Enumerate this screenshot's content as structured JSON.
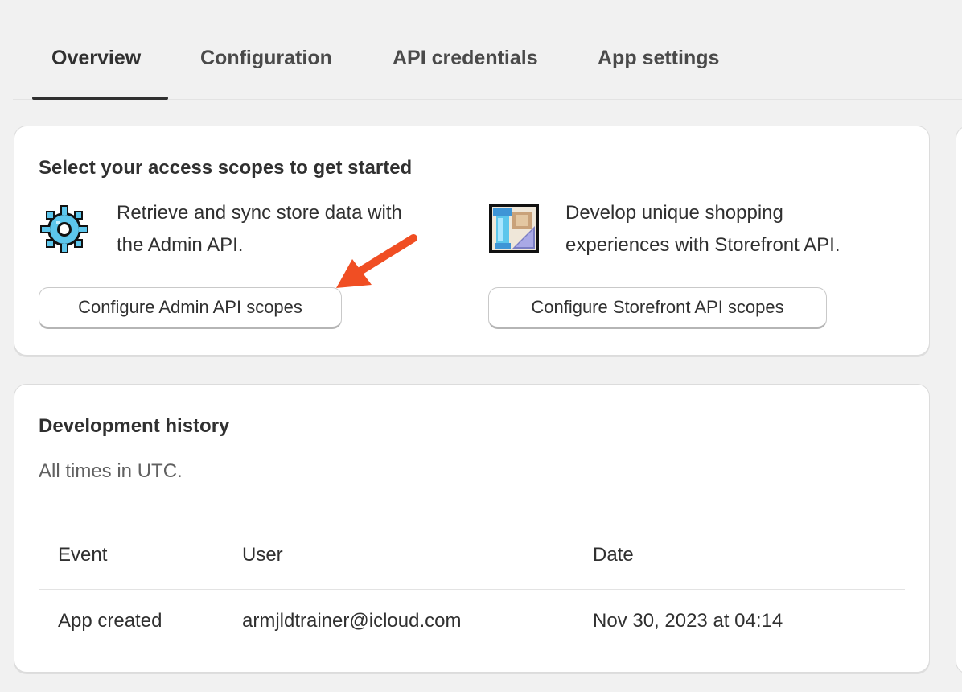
{
  "tabs": [
    {
      "label": "Overview",
      "active": true
    },
    {
      "label": "Configuration",
      "active": false
    },
    {
      "label": "API credentials",
      "active": false
    },
    {
      "label": "App settings",
      "active": false
    }
  ],
  "scopes_card": {
    "title": "Select your access scopes to get started",
    "admin": {
      "icon": "gear-icon",
      "line1": "Retrieve and sync store data with",
      "line2": "the Admin API.",
      "button_label": "Configure Admin API scopes"
    },
    "storefront": {
      "icon": "storefront-icon",
      "line1": "Develop unique shopping",
      "line2": "experiences with Storefront API.",
      "button_label": "Configure Storefront API scopes"
    }
  },
  "history_card": {
    "title": "Development history",
    "subtitle": "All times in UTC.",
    "columns": [
      "Event",
      "User",
      "Date"
    ],
    "rows": [
      {
        "event": "App created",
        "user": "armjldtrainer@icloud.com",
        "date": "Nov 30, 2023 at 04:14"
      }
    ]
  },
  "colors": {
    "accent_arrow": "#f04e23",
    "background": "#f1f1f1",
    "card": "#ffffff"
  }
}
